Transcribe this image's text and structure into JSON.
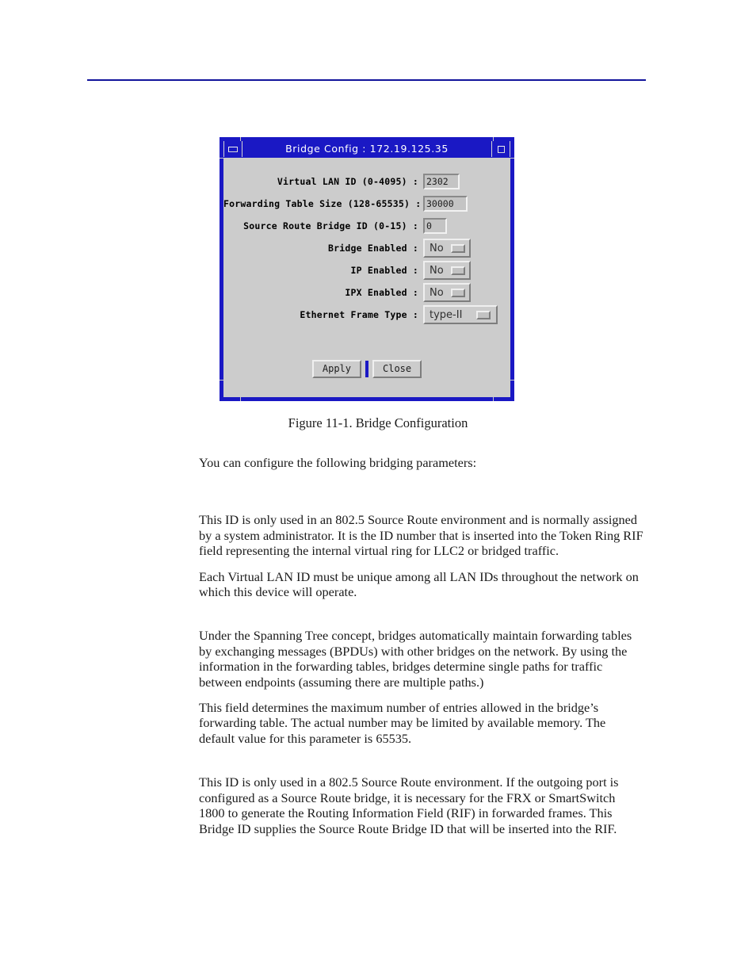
{
  "page": {
    "rule_color": "#12149b"
  },
  "dialog": {
    "title": "Bridge Config : 172.19.125.35",
    "titlebar_color": "#1a18c4",
    "face_color": "#cccccc",
    "minimize_icon": "minimize-icon",
    "maximize_icon": "maximize-icon",
    "fields": [
      {
        "label": "Virtual LAN ID (0-4095) :",
        "value": "2302",
        "kind": "text"
      },
      {
        "label": "Forwarding Table Size (128-65535) :",
        "value": "30000",
        "kind": "text"
      },
      {
        "label": "Source Route Bridge ID (0-15) :",
        "value": "0",
        "kind": "text"
      },
      {
        "label": "Bridge Enabled :",
        "value": "No",
        "kind": "option"
      },
      {
        "label": "IP Enabled :",
        "value": "No",
        "kind": "option"
      },
      {
        "label": "IPX Enabled :",
        "value": "No",
        "kind": "option"
      },
      {
        "label": "Ethernet Frame Type :",
        "value": "type-II",
        "kind": "option"
      }
    ],
    "buttons": {
      "apply_label": "Apply",
      "close_label": "Close",
      "focus_color": "#1a18c4"
    }
  },
  "figure": {
    "caption": "Figure 11-1.  Bridge Configuration"
  },
  "body": {
    "lead": "You can configure the following bridging parameters:",
    "paragraphs": [
      "This ID is only used in an 802.5 Source Route environment and is normally assigned by a system administrator. It is the ID number that is inserted into the Token Ring RIF field representing the internal virtual ring for LLC2 or bridged traffic.",
      "Each Virtual LAN ID must be unique among all LAN IDs throughout the network on which this device will operate.",
      "Under the Spanning Tree concept, bridges automatically maintain forwarding tables by exchanging messages (BPDUs) with other bridges on the network. By using the information in the forwarding tables, bridges determine single paths for traffic between endpoints (assuming there are multiple paths.)",
      "This field determines the maximum number of entries allowed in the bridge’s forwarding table. The actual number may be limited by available memory. The default value for this parameter is 65535.",
      "This ID is only used in a 802.5 Source Route environment. If the outgoing port is configured as a Source Route bridge, it is necessary for the FRX or SmartSwitch 1800 to generate the Routing Information Field (RIF) in forwarded frames. This Bridge ID supplies the Source Route Bridge ID that will be inserted into the RIF."
    ]
  }
}
